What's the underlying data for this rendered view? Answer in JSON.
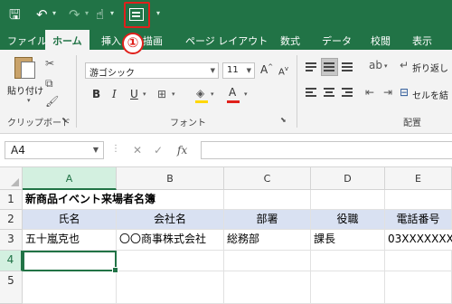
{
  "ribbon_tabs": [
    "ファイル",
    "ホーム",
    "挿入",
    "描画",
    "ページ レイアウト",
    "数式",
    "データ",
    "校閲",
    "表示"
  ],
  "callout_number": "①",
  "clipboard": {
    "paste_label": "貼り付け",
    "group_label": "クリップボード"
  },
  "font": {
    "name": "游ゴシック",
    "size": "11",
    "group_label": "フォント",
    "grow": "A",
    "shrink": "A",
    "bold": "B",
    "italic": "I",
    "underline": "U"
  },
  "alignment": {
    "wrap_label": "折り返し",
    "merge_label": "セルを結",
    "group_label": "配置"
  },
  "formula_bar": {
    "name_box": "A4",
    "fx": "fx",
    "formula": ""
  },
  "columns": [
    "A",
    "B",
    "C",
    "D",
    "E"
  ],
  "rows": [
    "1",
    "2",
    "3",
    "4",
    "5"
  ],
  "active_cell": "A4",
  "cells": {
    "title": "新商品イベント来場者名簿",
    "headers": [
      "氏名",
      "会社名",
      "部署",
      "役職",
      "電話番号"
    ],
    "row3": [
      "五十嵐克也",
      "〇〇商事株式会社",
      "総務部",
      "課長",
      "03XXXXXXXX"
    ]
  },
  "colors": {
    "excel_green": "#217346",
    "header_fill": "#d9e1f2",
    "highlight_red": "#e0201b"
  }
}
